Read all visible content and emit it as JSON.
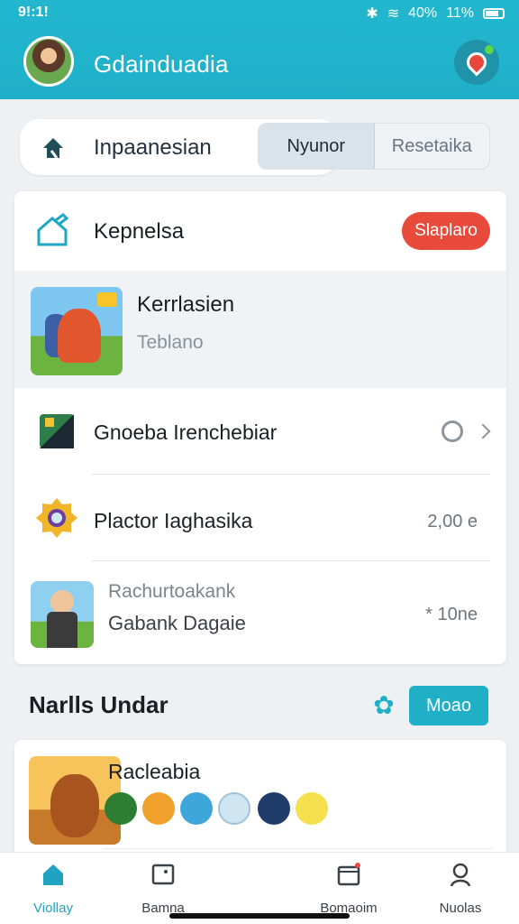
{
  "status_bar": {
    "time": "9!:1!",
    "battery_pct": "40%",
    "right_text": "11%"
  },
  "header": {
    "app_title": "Gdainduadia",
    "avatar_icon": "user-avatar",
    "notification_icon": "location-pin-icon"
  },
  "filter": {
    "label": "Inpaanesian",
    "segments": [
      {
        "label": "Nyunor",
        "active": true
      },
      {
        "label": "Resetaika",
        "active": false
      }
    ]
  },
  "main_card": {
    "title": "Kepnelsa",
    "pill_label": "Slaplaro",
    "featured": {
      "title": "Kerrlasien",
      "subtitle": "Teblano"
    },
    "rows": [
      {
        "label": "Gnoeba Irenchebiar",
        "value": "",
        "control": "radio",
        "icon": "app-tile-icon"
      },
      {
        "label": "Plactor Iaghasika",
        "value": "2,00 e",
        "control": "",
        "icon": "badge-icon"
      },
      {
        "label_top": "Rachurtoakank",
        "label": "Gabank Dagaie",
        "value": "* 10ne",
        "control": "",
        "icon": "game-thumb-icon"
      }
    ]
  },
  "section": {
    "title": "Narlls Undar",
    "button_label": "Moao",
    "gear_icon": "gear-icon"
  },
  "list_card": {
    "title": "Racleabia",
    "mini_icons": 7
  },
  "bottom_nav": [
    {
      "label": "Viollay",
      "icon": "home-icon",
      "active": true
    },
    {
      "label": "Bamna",
      "icon": "folder-icon",
      "active": false
    },
    {
      "label": "Bomaoim",
      "icon": "calendar-icon",
      "active": false
    },
    {
      "label": "Nuolas",
      "icon": "profile-icon",
      "active": false
    }
  ],
  "colors": {
    "accent": "#1fb0c8",
    "danger": "#e84b3c"
  }
}
